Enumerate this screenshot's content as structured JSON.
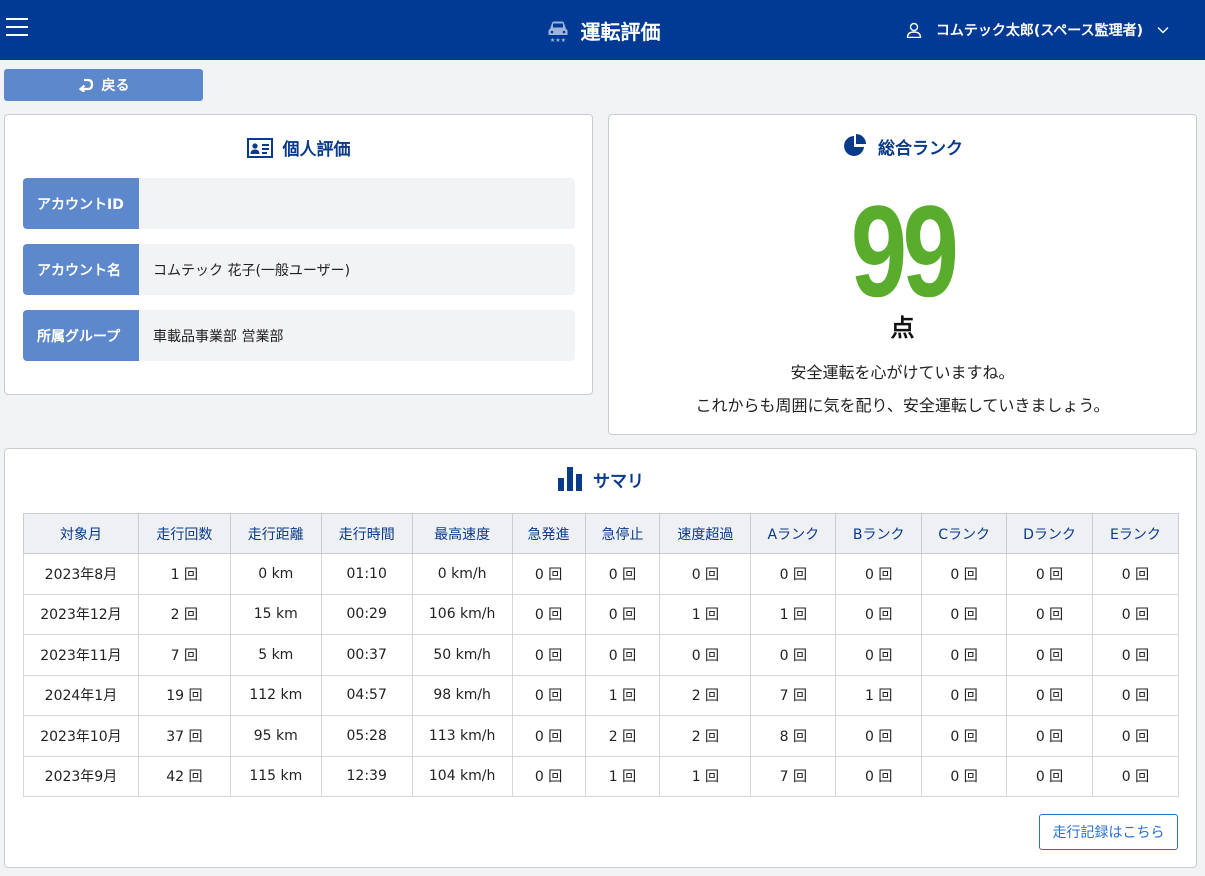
{
  "header": {
    "title": "運転評価",
    "user_name": "コムテック太郎(スペース監理者)"
  },
  "back_label": "戻る",
  "personal": {
    "title": "個人評価",
    "rows": [
      {
        "label": "アカウントID",
        "value": ""
      },
      {
        "label": "アカウント名",
        "value": "コムテック 花子(一般ユーザー)"
      },
      {
        "label": "所属グループ",
        "value": "車載品事業部 営業部"
      }
    ]
  },
  "rank": {
    "title": "総合ランク",
    "score": "99",
    "unit": "点",
    "message_line1": "安全運転を心がけていますね。",
    "message_line2": "これからも周囲に気を配り、安全運転していきましょう。",
    "score_color": "#5aac2c"
  },
  "summary": {
    "title": "サマリ",
    "columns": [
      "対象月",
      "走行回数",
      "走行距離",
      "走行時間",
      "最高速度",
      "急発進",
      "急停止",
      "速度超過",
      "Aランク",
      "Bランク",
      "Cランク",
      "Dランク",
      "Eランク"
    ],
    "rows": [
      [
        "2023年8月",
        "1 回",
        "0 km",
        "01:10",
        "0 km/h",
        "0 回",
        "0 回",
        "0 回",
        "0 回",
        "0 回",
        "0 回",
        "0 回",
        "0 回"
      ],
      [
        "2023年12月",
        "2 回",
        "15 km",
        "00:29",
        "106 km/h",
        "0 回",
        "0 回",
        "1 回",
        "1 回",
        "0 回",
        "0 回",
        "0 回",
        "0 回"
      ],
      [
        "2023年11月",
        "7 回",
        "5 km",
        "00:37",
        "50 km/h",
        "0 回",
        "0 回",
        "0 回",
        "0 回",
        "0 回",
        "0 回",
        "0 回",
        "0 回"
      ],
      [
        "2024年1月",
        "19 回",
        "112 km",
        "04:57",
        "98 km/h",
        "0 回",
        "1 回",
        "2 回",
        "7 回",
        "1 回",
        "0 回",
        "0 回",
        "0 回"
      ],
      [
        "2023年10月",
        "37 回",
        "95 km",
        "05:28",
        "113 km/h",
        "0 回",
        "2 回",
        "2 回",
        "8 回",
        "0 回",
        "0 回",
        "0 回",
        "0 回"
      ],
      [
        "2023年9月",
        "42 回",
        "115 km",
        "12:39",
        "104 km/h",
        "0 回",
        "1 回",
        "1 回",
        "7 回",
        "0 回",
        "0 回",
        "0 回",
        "0 回"
      ]
    ],
    "link_label": "走行記録はこちら"
  },
  "colors": {
    "header_bg": "#003a94",
    "accent": "#5e88cc",
    "title_text": "#0a3a8a"
  },
  "icons": {
    "menu": "hamburger-icon",
    "app": "car-icon",
    "user": "user-icon",
    "back": "return-arrow-icon",
    "personal": "id-card-icon",
    "rank": "pie-chart-icon",
    "summary": "bar-chart-icon"
  }
}
